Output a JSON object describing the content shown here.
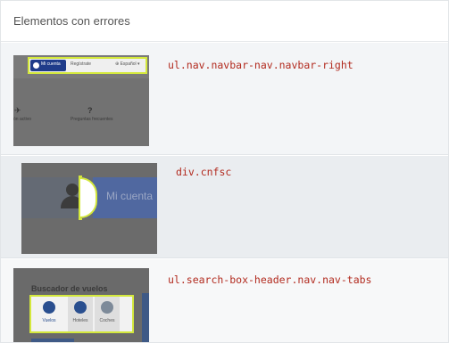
{
  "panel": {
    "title": "Elementos con errores"
  },
  "rows": [
    {
      "selector": "ul.nav.navbar-nav.navbar-right",
      "thumb": {
        "button_label": "Mi cuenta",
        "register_label": "Regístrate",
        "language_label": "Español",
        "link_left": "ón activo",
        "link_right": "Preguntas frecuentes",
        "icon_left": "plane-icon",
        "icon_right": "question-icon"
      }
    },
    {
      "selector": "div.cnfsc",
      "thumb": {
        "label": "Mi cuenta",
        "icon": "user-avatar-icon"
      }
    },
    {
      "selector": "ul.search-box-header.nav.nav-tabs",
      "thumb": {
        "title": "Buscador de vuelos",
        "tabs": [
          {
            "label": "Vuelos",
            "icon": "plane-icon"
          },
          {
            "label": "Hoteles",
            "icon": "bed-icon"
          },
          {
            "label": "Coches",
            "icon": "car-icon"
          }
        ]
      }
    }
  ],
  "colors": {
    "selector_text": "#b22a1e",
    "highlight": "#d4e83c",
    "brand_blue": "#1f3c8a"
  }
}
